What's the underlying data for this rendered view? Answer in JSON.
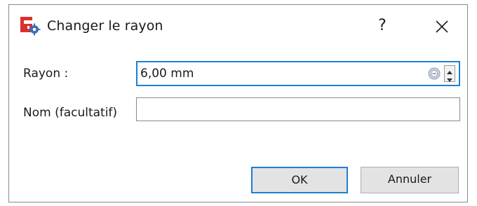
{
  "window": {
    "title": "Changer le rayon",
    "help_label": "?",
    "app_icon": "freecad-app-icon",
    "close_icon": "close-icon"
  },
  "form": {
    "radius": {
      "label": "Rayon :",
      "value": "6,00 mm",
      "expression_icon": "expression-icon",
      "spin_icon": "spin-arrows-icon"
    },
    "name": {
      "label": "Nom (facultatif)",
      "value": ""
    }
  },
  "buttons": {
    "ok_label": "OK",
    "cancel_label": "Annuler"
  },
  "colors": {
    "accent": "#1e7fd6",
    "button_bg": "#e3e3e3",
    "app_icon_red": "#d9302c",
    "app_icon_blue": "#3b6fb6"
  }
}
